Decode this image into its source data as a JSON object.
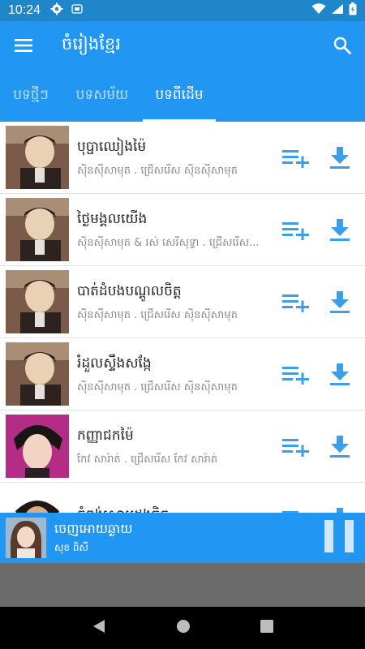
{
  "status_bar": {
    "time": "10:24",
    "icons": [
      "gear-icon",
      "sim-icon"
    ],
    "right_icons": [
      "wifi-icon",
      "signal-icon",
      "battery-icon"
    ]
  },
  "app_bar": {
    "title": "ចំរៀងខ្មែរ",
    "menu_icon": "hamburger-menu-icon",
    "search_icon": "search-icon"
  },
  "tabs": [
    {
      "label": "បទថ្មីៗ",
      "active": false
    },
    {
      "label": "បទសម័យ",
      "active": false
    },
    {
      "label": "បទពីដើម",
      "active": true
    }
  ],
  "songs": [
    {
      "title": "បុប្ផាឈៀងម៉ៃ",
      "subtitle": "ស៊ិនស៊ីសាមុត . ជ្រើសរើស ស៊ិនស៊ីសាមុត"
    },
    {
      "title": "ថ្ងៃមង្គលយើង",
      "subtitle": "ស៊ិនស៊ីសាមុត & រស់ សេរីសុទ្ធា . ជ្រើសរើស..."
    },
    {
      "title": "បាត់ដំបងបណ្តូលចិត្ត",
      "subtitle": "ស៊ិនស៊ីសាមុត . ជ្រើសរើស ស៊ិនស៊ីសាមុត"
    },
    {
      "title": "រំដួលស្ទឹងសង្កែ",
      "subtitle": "ស៊ិនស៊ីសាមុត . ជ្រើសរើស ស៊ិនស៊ីសាមុត"
    },
    {
      "title": "កញ្ញាជកម៉ៃ",
      "subtitle": "កែវ សារ៉ាត់ . ជ្រើសរើស កែវ សារ៉ាត់"
    },
    {
      "title": "កំពង់សោមដួងចិត្ត",
      "subtitle": ""
    }
  ],
  "row_actions": {
    "add_icon": "playlist-add-icon",
    "download_icon": "download-icon"
  },
  "player": {
    "title": "ចេញអោយឆ្ងាយ",
    "artist": "សុខ ពិសី",
    "pause_icon": "pause-icon"
  },
  "nav_bar": {
    "icons": [
      "back-icon",
      "home-icon",
      "recents-icon"
    ]
  },
  "colors": {
    "primary": "#2196f3",
    "status_bar": "#1f87c9",
    "accent_icons": "#2e9bf0"
  }
}
